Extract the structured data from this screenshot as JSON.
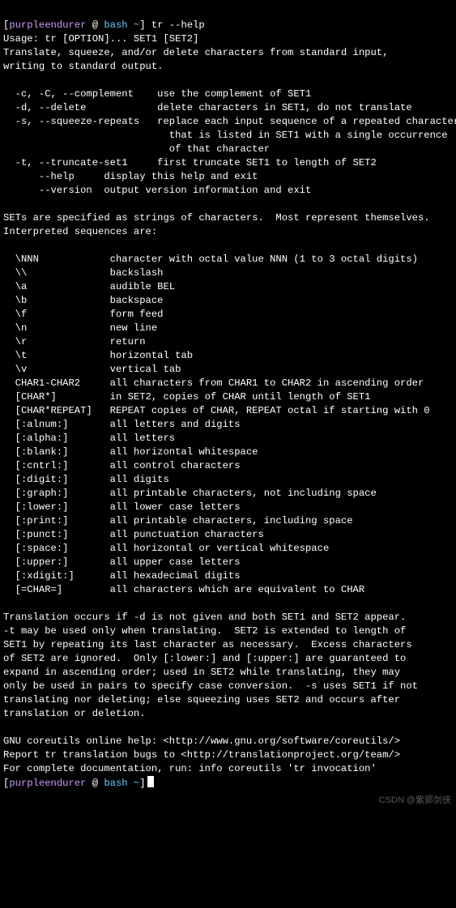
{
  "prompt1": {
    "user_host": "purpleendurer",
    "sep1": " @ ",
    "shell_path": "bash ~",
    "close": "]",
    "command": " tr --help"
  },
  "help": {
    "usage": "Usage: tr [OPTION]... SET1 [SET2]",
    "desc1": "Translate, squeeze, and/or delete characters from standard input,",
    "desc2": "writing to standard output.",
    "blank": "",
    "opt_c": "  -c, -C, --complement    use the complement of SET1",
    "opt_d": "  -d, --delete            delete characters in SET1, do not translate",
    "opt_s1": "  -s, --squeeze-repeats   replace each input sequence of a repeated character",
    "opt_s2": "                            that is listed in SET1 with a single occurrence",
    "opt_s3": "                            of that character",
    "opt_t": "  -t, --truncate-set1     first truncate SET1 to length of SET2",
    "opt_help": "      --help     display this help and exit",
    "opt_version": "      --version  output version information and exit",
    "sets_intro1": "SETs are specified as strings of characters.  Most represent themselves.",
    "sets_intro2": "Interpreted sequences are:",
    "seq_NNN": "  \\NNN            character with octal value NNN (1 to 3 octal digits)",
    "seq_bs": "  \\\\              backslash",
    "seq_a": "  \\a              audible BEL",
    "seq_b": "  \\b              backspace",
    "seq_f": "  \\f              form feed",
    "seq_n": "  \\n              new line",
    "seq_r": "  \\r              return",
    "seq_t": "  \\t              horizontal tab",
    "seq_v": "  \\v              vertical tab",
    "seq_range": "  CHAR1-CHAR2     all characters from CHAR1 to CHAR2 in ascending order",
    "seq_star": "  [CHAR*]         in SET2, copies of CHAR until length of SET1",
    "seq_repeat": "  [CHAR*REPEAT]   REPEAT copies of CHAR, REPEAT octal if starting with 0",
    "seq_alnum": "  [:alnum:]       all letters and digits",
    "seq_alpha": "  [:alpha:]       all letters",
    "seq_blank": "  [:blank:]       all horizontal whitespace",
    "seq_cntrl": "  [:cntrl:]       all control characters",
    "seq_digit": "  [:digit:]       all digits",
    "seq_graph": "  [:graph:]       all printable characters, not including space",
    "seq_lower": "  [:lower:]       all lower case letters",
    "seq_print": "  [:print:]       all printable characters, including space",
    "seq_punct": "  [:punct:]       all punctuation characters",
    "seq_space": "  [:space:]       all horizontal or vertical whitespace",
    "seq_upper": "  [:upper:]       all upper case letters",
    "seq_xdigit": "  [:xdigit:]      all hexadecimal digits",
    "seq_equiv": "  [=CHAR=]        all characters which are equivalent to CHAR",
    "para1": "Translation occurs if -d is not given and both SET1 and SET2 appear.",
    "para2": "-t may be used only when translating.  SET2 is extended to length of",
    "para3": "SET1 by repeating its last character as necessary.  Excess characters",
    "para4": "of SET2 are ignored.  Only [:lower:] and [:upper:] are guaranteed to",
    "para5": "expand in ascending order; used in SET2 while translating, they may",
    "para6": "only be used in pairs to specify case conversion.  -s uses SET1 if not",
    "para7": "translating nor deleting; else squeezing uses SET2 and occurs after",
    "para8": "translation or deletion.",
    "footer1": "GNU coreutils online help: <http://www.gnu.org/software/coreutils/>",
    "footer2": "Report tr translation bugs to <http://translationproject.org/team/>",
    "footer3": "For complete documentation, run: info coreutils 'tr invocation'"
  },
  "prompt2": {
    "user_host": "purpleendurer",
    "sep1": " @ ",
    "shell_path": "bash ~",
    "close": "]"
  },
  "watermark": "CSDN @紫郢剑侠"
}
